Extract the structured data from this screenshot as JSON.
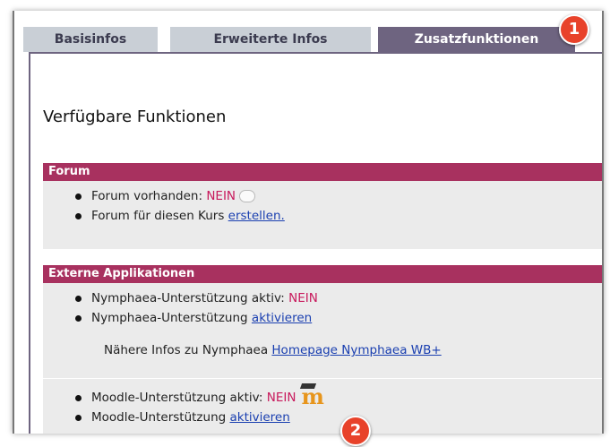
{
  "tabs": {
    "basis": "Basisinfos",
    "erweitert": "Erweiterte Infos",
    "zusatz": "Zusatzfunktionen"
  },
  "page_title": "Verfügbare Funktionen",
  "forum": {
    "header": "Forum",
    "exists_label": "Forum vorhanden: ",
    "exists_value": "NEIN",
    "create_prefix": "Forum für diesen Kurs ",
    "create_link": "erstellen."
  },
  "external": {
    "header": "Externe Applikationen",
    "nymphaea_active_label": "Nymphaea-Unterstützung aktiv: ",
    "nymphaea_active_value": "NEIN",
    "nymphaea_activate_prefix": "Nymphaea-Unterstützung ",
    "nymphaea_activate_link": "aktivieren",
    "nymphaea_info_prefix": "Nähere Infos zu Nymphaea ",
    "nymphaea_info_link": "Homepage Nymphaea WB+",
    "moodle_active_label": "Moodle-Unterstützung aktiv: ",
    "moodle_active_value": "NEIN",
    "moodle_activate_prefix": "Moodle-Unterstützung ",
    "moodle_activate_link": "aktivieren",
    "moodle_logo_letter": "m"
  },
  "badges": {
    "one": "1",
    "two": "2"
  },
  "colors": {
    "accent": "#a8315f",
    "tab_active": "#6e6480",
    "tab_inactive": "#c9cfd6",
    "nein": "#c8195c",
    "badge": "#e8422a",
    "moodle": "#e7951c"
  },
  "icons": {
    "forum": "speech-bubble-icon",
    "moodle": "moodle-logo-icon"
  }
}
